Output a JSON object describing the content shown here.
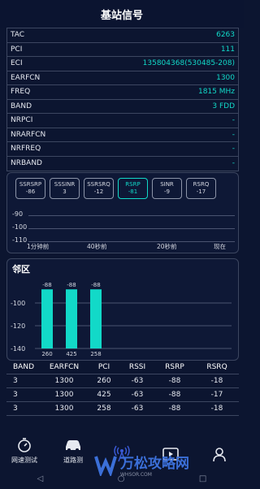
{
  "header": {
    "title": "基站信号"
  },
  "info_rows": [
    {
      "key": "TAC",
      "value": "6263"
    },
    {
      "key": "PCI",
      "value": "111"
    },
    {
      "key": "ECI",
      "value": "135804368(530485-208)"
    },
    {
      "key": "EARFCN",
      "value": "1300"
    },
    {
      "key": "FREQ",
      "value": "1815 MHz"
    },
    {
      "key": "BAND",
      "value": "3 FDD"
    },
    {
      "key": "NRPCI",
      "value": "-"
    },
    {
      "key": "NRARFCN",
      "value": "-"
    },
    {
      "key": "NRFREQ",
      "value": "-"
    },
    {
      "key": "NRBAND",
      "value": "-"
    }
  ],
  "trend": {
    "metrics": [
      {
        "name": "SSRSRP",
        "value": "-86"
      },
      {
        "name": "SSSINR",
        "value": "3"
      },
      {
        "name": "SSRSRQ",
        "value": "-12"
      },
      {
        "name": "RSRP",
        "value": "-81"
      },
      {
        "name": "SINR",
        "value": "-9"
      },
      {
        "name": "RSRQ",
        "value": "-17"
      }
    ],
    "active_metric": "RSRP",
    "y_ticks": [
      "-90",
      "-100",
      "-110"
    ],
    "x_ticks": [
      "1分钟前",
      "40秒前",
      "20秒前",
      "现在"
    ]
  },
  "cells": {
    "title": "邻区",
    "chart_data": {
      "type": "bar",
      "categories": [
        "260",
        "425",
        "258"
      ],
      "values": [
        -88,
        -88,
        -88
      ],
      "y_ticks": [
        "-100",
        "-120",
        "-140"
      ],
      "ylim": [
        -140,
        -80
      ],
      "bar_color": "#12d9c8"
    },
    "table": {
      "columns": [
        "BAND",
        "EARFCN",
        "PCI",
        "RSSI",
        "RSRP",
        "RSRQ"
      ],
      "rows": [
        [
          "3",
          "1300",
          "260",
          "-63",
          "-88",
          "-18"
        ],
        [
          "3",
          "1300",
          "425",
          "-63",
          "-88",
          "-17"
        ],
        [
          "3",
          "1300",
          "258",
          "-63",
          "-88",
          "-18"
        ]
      ]
    }
  },
  "nav": {
    "items": [
      {
        "label": "网速测试",
        "icon": "stopwatch-icon"
      },
      {
        "label": "道路测",
        "icon": "car-icon"
      },
      {
        "label": "",
        "icon": "signal-tower-icon"
      },
      {
        "label": "",
        "icon": "video-icon"
      },
      {
        "label": "",
        "icon": "user-icon"
      }
    ],
    "active_index": 2
  },
  "watermark": {
    "name": "万松攻略网",
    "url": "WHSOR.COM"
  }
}
